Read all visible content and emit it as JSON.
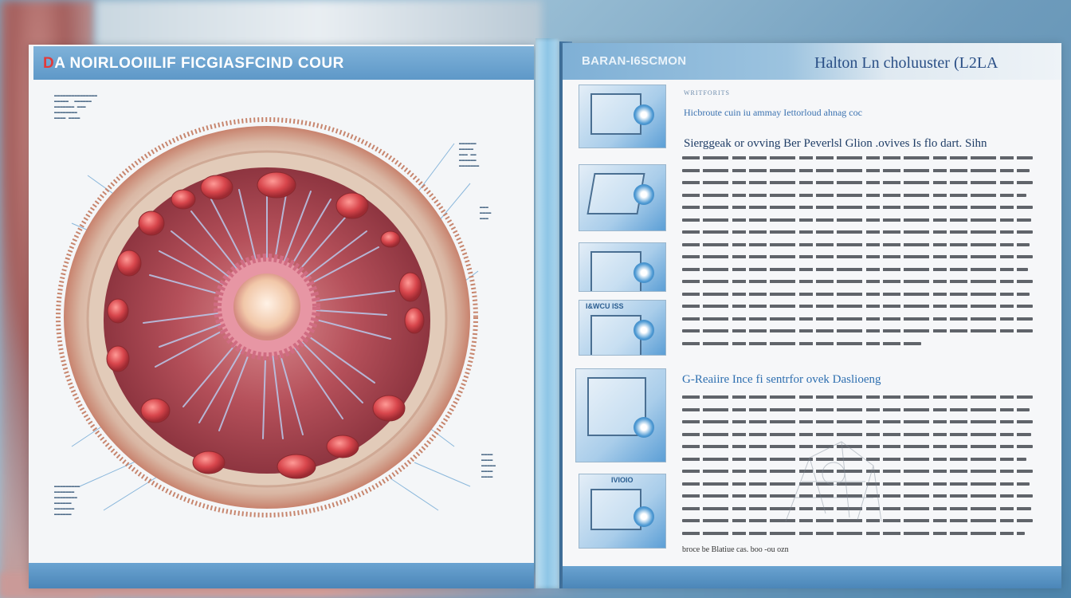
{
  "left_page": {
    "title_first_letter": "D",
    "title_rest": "A NOIRLOOIILIF FICGIASFCIND COUR"
  },
  "right_page": {
    "section_label": "BARAN-I6SCMON",
    "title": "Halton Ln choluuster (L2LA",
    "label_small": "WRITFORITS",
    "subheading": "Hicbroute cuin iu ammay   Iettorloud ahnag coc",
    "heading_1": "Sierggeak or ovving Ber Peverlsl Glion   .ovives Is flo dart. Sihn",
    "heading_2": "G-Reaiire Ince fi sentrfor ovek Daslioeng",
    "thumb_label_4": "I&WCU  ISS",
    "thumb_label_6": "IVIOIO",
    "closing_text": "broce be Blatiue cas. boo -ou ozn"
  },
  "colors": {
    "accent_blue": "#5e98c8",
    "title_blue": "#2a4f86",
    "tissue_red": "#b5505a"
  }
}
